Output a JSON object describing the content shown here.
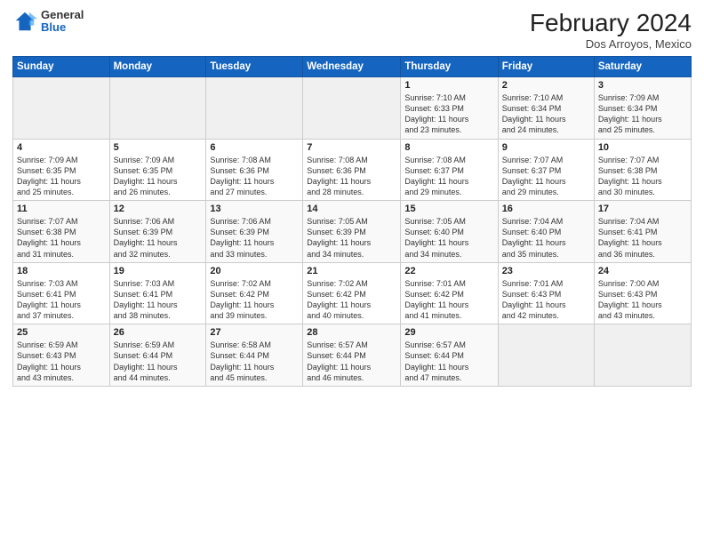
{
  "header": {
    "logo_general": "General",
    "logo_blue": "Blue",
    "month_title": "February 2024",
    "location": "Dos Arroyos, Mexico"
  },
  "days_of_week": [
    "Sunday",
    "Monday",
    "Tuesday",
    "Wednesday",
    "Thursday",
    "Friday",
    "Saturday"
  ],
  "weeks": [
    [
      {
        "day": "",
        "info": ""
      },
      {
        "day": "",
        "info": ""
      },
      {
        "day": "",
        "info": ""
      },
      {
        "day": "",
        "info": ""
      },
      {
        "day": "1",
        "info": "Sunrise: 7:10 AM\nSunset: 6:33 PM\nDaylight: 11 hours\nand 23 minutes."
      },
      {
        "day": "2",
        "info": "Sunrise: 7:10 AM\nSunset: 6:34 PM\nDaylight: 11 hours\nand 24 minutes."
      },
      {
        "day": "3",
        "info": "Sunrise: 7:09 AM\nSunset: 6:34 PM\nDaylight: 11 hours\nand 25 minutes."
      }
    ],
    [
      {
        "day": "4",
        "info": "Sunrise: 7:09 AM\nSunset: 6:35 PM\nDaylight: 11 hours\nand 25 minutes."
      },
      {
        "day": "5",
        "info": "Sunrise: 7:09 AM\nSunset: 6:35 PM\nDaylight: 11 hours\nand 26 minutes."
      },
      {
        "day": "6",
        "info": "Sunrise: 7:08 AM\nSunset: 6:36 PM\nDaylight: 11 hours\nand 27 minutes."
      },
      {
        "day": "7",
        "info": "Sunrise: 7:08 AM\nSunset: 6:36 PM\nDaylight: 11 hours\nand 28 minutes."
      },
      {
        "day": "8",
        "info": "Sunrise: 7:08 AM\nSunset: 6:37 PM\nDaylight: 11 hours\nand 29 minutes."
      },
      {
        "day": "9",
        "info": "Sunrise: 7:07 AM\nSunset: 6:37 PM\nDaylight: 11 hours\nand 29 minutes."
      },
      {
        "day": "10",
        "info": "Sunrise: 7:07 AM\nSunset: 6:38 PM\nDaylight: 11 hours\nand 30 minutes."
      }
    ],
    [
      {
        "day": "11",
        "info": "Sunrise: 7:07 AM\nSunset: 6:38 PM\nDaylight: 11 hours\nand 31 minutes."
      },
      {
        "day": "12",
        "info": "Sunrise: 7:06 AM\nSunset: 6:39 PM\nDaylight: 11 hours\nand 32 minutes."
      },
      {
        "day": "13",
        "info": "Sunrise: 7:06 AM\nSunset: 6:39 PM\nDaylight: 11 hours\nand 33 minutes."
      },
      {
        "day": "14",
        "info": "Sunrise: 7:05 AM\nSunset: 6:39 PM\nDaylight: 11 hours\nand 34 minutes."
      },
      {
        "day": "15",
        "info": "Sunrise: 7:05 AM\nSunset: 6:40 PM\nDaylight: 11 hours\nand 34 minutes."
      },
      {
        "day": "16",
        "info": "Sunrise: 7:04 AM\nSunset: 6:40 PM\nDaylight: 11 hours\nand 35 minutes."
      },
      {
        "day": "17",
        "info": "Sunrise: 7:04 AM\nSunset: 6:41 PM\nDaylight: 11 hours\nand 36 minutes."
      }
    ],
    [
      {
        "day": "18",
        "info": "Sunrise: 7:03 AM\nSunset: 6:41 PM\nDaylight: 11 hours\nand 37 minutes."
      },
      {
        "day": "19",
        "info": "Sunrise: 7:03 AM\nSunset: 6:41 PM\nDaylight: 11 hours\nand 38 minutes."
      },
      {
        "day": "20",
        "info": "Sunrise: 7:02 AM\nSunset: 6:42 PM\nDaylight: 11 hours\nand 39 minutes."
      },
      {
        "day": "21",
        "info": "Sunrise: 7:02 AM\nSunset: 6:42 PM\nDaylight: 11 hours\nand 40 minutes."
      },
      {
        "day": "22",
        "info": "Sunrise: 7:01 AM\nSunset: 6:42 PM\nDaylight: 11 hours\nand 41 minutes."
      },
      {
        "day": "23",
        "info": "Sunrise: 7:01 AM\nSunset: 6:43 PM\nDaylight: 11 hours\nand 42 minutes."
      },
      {
        "day": "24",
        "info": "Sunrise: 7:00 AM\nSunset: 6:43 PM\nDaylight: 11 hours\nand 43 minutes."
      }
    ],
    [
      {
        "day": "25",
        "info": "Sunrise: 6:59 AM\nSunset: 6:43 PM\nDaylight: 11 hours\nand 43 minutes."
      },
      {
        "day": "26",
        "info": "Sunrise: 6:59 AM\nSunset: 6:44 PM\nDaylight: 11 hours\nand 44 minutes."
      },
      {
        "day": "27",
        "info": "Sunrise: 6:58 AM\nSunset: 6:44 PM\nDaylight: 11 hours\nand 45 minutes."
      },
      {
        "day": "28",
        "info": "Sunrise: 6:57 AM\nSunset: 6:44 PM\nDaylight: 11 hours\nand 46 minutes."
      },
      {
        "day": "29",
        "info": "Sunrise: 6:57 AM\nSunset: 6:44 PM\nDaylight: 11 hours\nand 47 minutes."
      },
      {
        "day": "",
        "info": ""
      },
      {
        "day": "",
        "info": ""
      }
    ]
  ]
}
